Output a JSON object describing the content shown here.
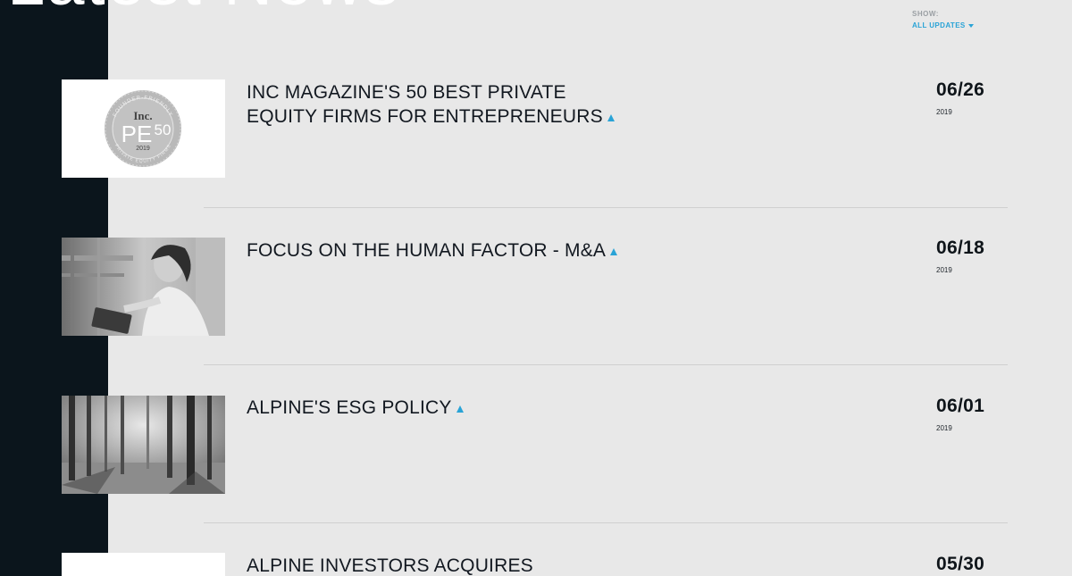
{
  "header": {
    "heading": "Latest News"
  },
  "filter": {
    "label": "SHOW:",
    "selected": "ALL UPDATES"
  },
  "articles": [
    {
      "title": "INC MAGAZINE'S 50 BEST PRIVATE EQUITY FIRMS FOR ENTREPRENEURS",
      "date": "06/26",
      "year": "2019",
      "thumb": "inc-pe50-badge"
    },
    {
      "title": "FOCUS ON THE HUMAN FACTOR - M&A",
      "date": "06/18",
      "year": "2019",
      "thumb": "woman-with-tablet-photo"
    },
    {
      "title": "ALPINE'S ESG POLICY",
      "date": "06/01",
      "year": "2019",
      "thumb": "forest-photo"
    },
    {
      "title": "ALPINE INVESTORS ACQUIRES",
      "date": "05/30",
      "year": "",
      "thumb": "white-thumbnail"
    }
  ],
  "badge": {
    "brand": "Inc.",
    "main": "PE",
    "number": "50",
    "year": "2019",
    "ring_top": "FOUNDER-FRIENDLY",
    "ring_bottom": "PRIVATE EQUITY FIRMS"
  },
  "colors": {
    "background": "#e8e8e8",
    "dark_band": "#0b151c",
    "accent": "#29a3d6"
  }
}
